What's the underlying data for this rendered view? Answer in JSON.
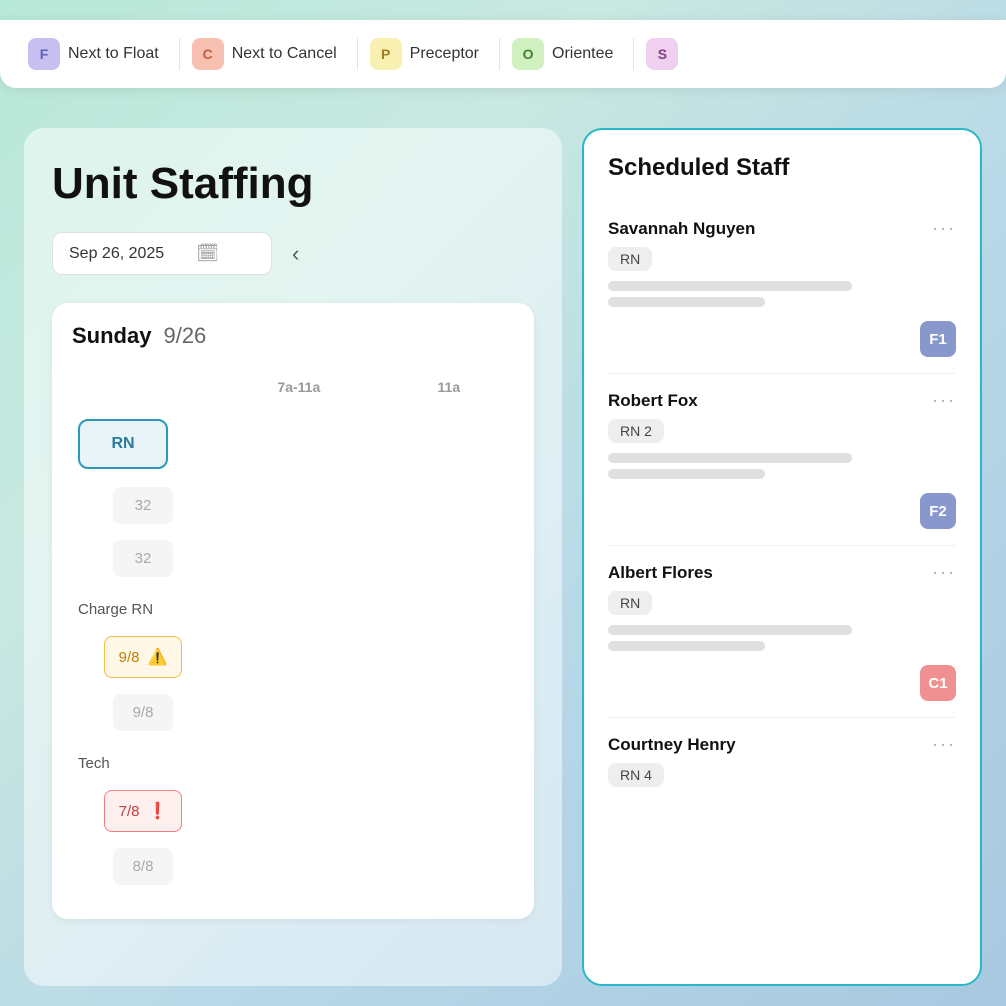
{
  "legend": {
    "items": [
      {
        "id": "float",
        "badge_letter": "F",
        "badge_color": "#c8c0f0",
        "text_color": "#6060c0",
        "label": "Next to Float"
      },
      {
        "id": "cancel",
        "badge_letter": "C",
        "badge_color": "#f8c0b0",
        "text_color": "#c06040",
        "label": "Next to Cancel"
      },
      {
        "id": "preceptor",
        "badge_letter": "P",
        "badge_color": "#f8f0b0",
        "text_color": "#a08020",
        "label": "Preceptor"
      },
      {
        "id": "orientee",
        "badge_letter": "O",
        "badge_color": "#d0f0c0",
        "text_color": "#408030",
        "label": "Orientee"
      },
      {
        "id": "s",
        "badge_letter": "S",
        "badge_color": "#f0d0f0",
        "text_color": "#804080",
        "label": "..."
      }
    ]
  },
  "left_panel": {
    "title": "Unit Staffing",
    "date_value": "Sep 26, 2025",
    "date_placeholder": "Sep 26, 2025",
    "day_name": "Sunday",
    "day_date": "9/26",
    "time_columns": [
      "7a-11a",
      "11a"
    ],
    "rows": [
      {
        "label": "",
        "role_badge": "RN",
        "col1": "32",
        "col2": "32",
        "type": "role"
      },
      {
        "label": "Charge RN",
        "col1": "9/8",
        "col1_type": "warning",
        "col2": "9/8",
        "col2_type": "normal"
      },
      {
        "label": "Tech",
        "col1": "7/8",
        "col1_type": "error",
        "col2": "8/8",
        "col2_type": "normal"
      }
    ]
  },
  "right_panel": {
    "title": "Scheduled Staff",
    "staff": [
      {
        "name": "Savannah Nguyen",
        "role": "RN",
        "badge": "F1",
        "badge_class": "badge-f1"
      },
      {
        "name": "Robert Fox",
        "role": "RN 2",
        "badge": "F2",
        "badge_class": "badge-f2"
      },
      {
        "name": "Albert Flores",
        "role": "RN",
        "badge": "C1",
        "badge_class": "badge-c1"
      },
      {
        "name": "Courtney Henry",
        "role": "RN 4",
        "badge": "",
        "badge_class": ""
      }
    ]
  },
  "icons": {
    "calendar": "📅",
    "chevron_left": "‹",
    "more": "···",
    "warning": "⚠",
    "error": "❗"
  }
}
